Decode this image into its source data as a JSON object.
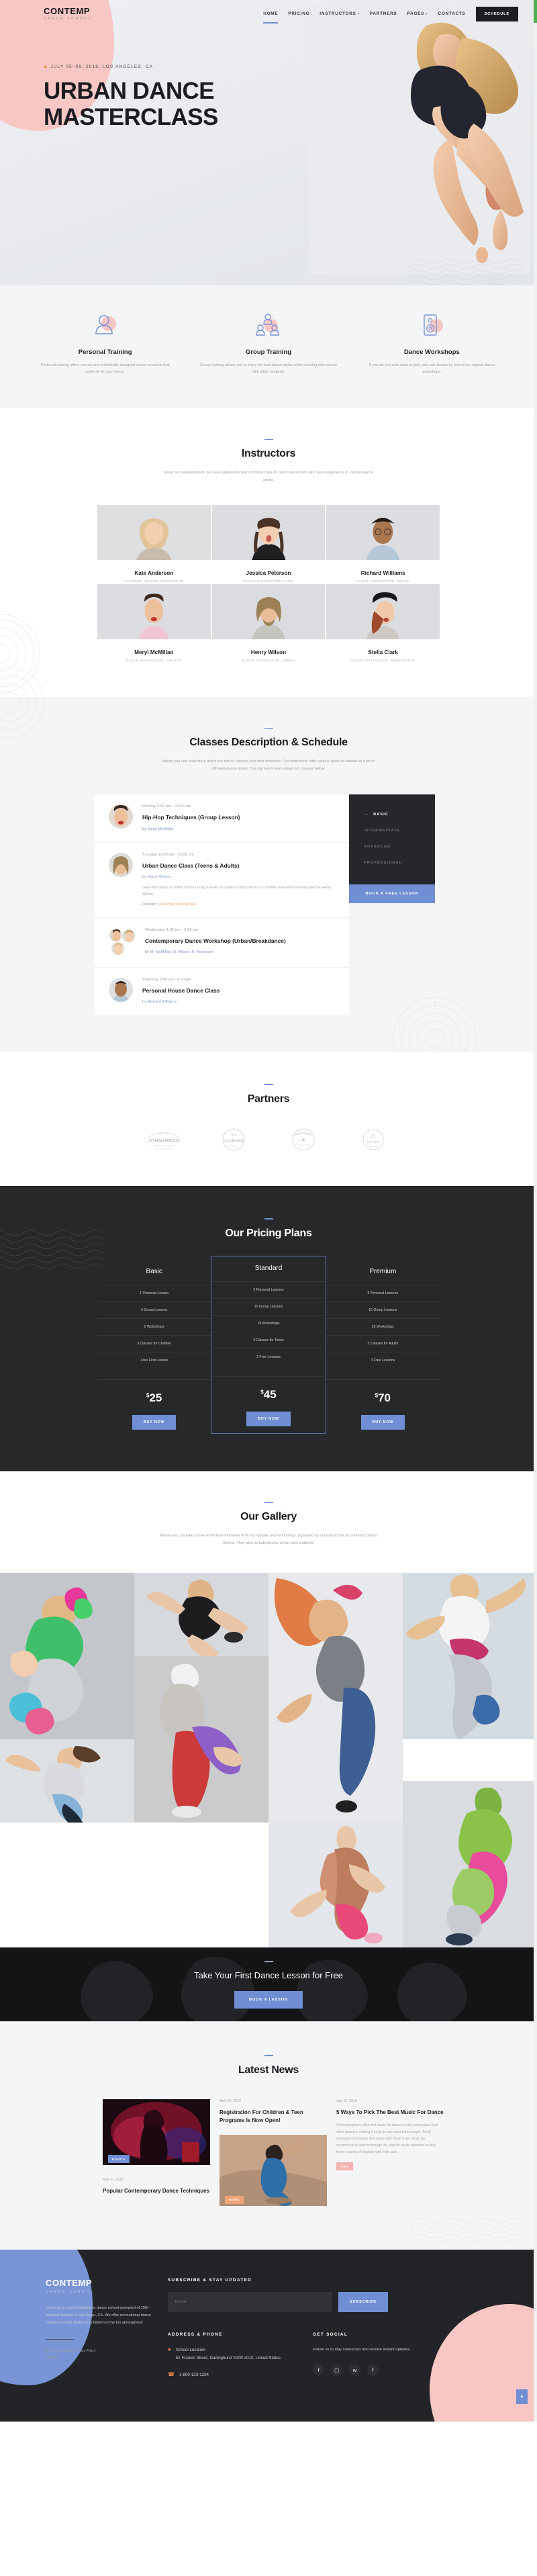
{
  "brand": {
    "name": "CONTEMP",
    "sub": "DANCE SCHOOL"
  },
  "nav": {
    "items": [
      {
        "label": "HOME",
        "caret": "",
        "active": true
      },
      {
        "label": "PRICING",
        "caret": "",
        "active": false
      },
      {
        "label": "INSTRUCTORS",
        "caret": "▾",
        "active": false
      },
      {
        "label": "PARTNERS",
        "caret": "",
        "active": false
      },
      {
        "label": "PAGES",
        "caret": "▾",
        "active": false
      },
      {
        "label": "CONTACTS",
        "caret": "",
        "active": false
      }
    ],
    "cta_label": "SCHEDULE"
  },
  "hero": {
    "date": "JULY 05–09, 2018, LOS ANGELES, CA",
    "title_line1": "URBAN DANCE",
    "title_line2": "MASTERCLASS",
    "pin_icon": "location-pin-icon"
  },
  "services": [
    {
      "icon": "person-icon",
      "title": "Personal Training",
      "text": "Personal training offers one-on-one individually designed dance sessions that perfectly fit your needs."
    },
    {
      "icon": "group-icon",
      "title": "Group Training",
      "text": "Group training allows you to enjoy the best dance styles while learning new moves with other students."
    },
    {
      "icon": "speaker-icon",
      "title": "Dance Workshops",
      "text": "If you are not sure what to pick, you can always try one of our regular dance workshops."
    }
  ],
  "instructors": {
    "title": "Instructors",
    "subtitle": "Since our establishment, we have gathered a team of more than 20 dance instructors who have experience in various dance styles.",
    "people": [
      {
        "name": "Kate Anderson",
        "role": "FOUNDER, SENIOR INSTRUCTOR"
      },
      {
        "name": "Jessica Peterson",
        "role": "DANCE INSTRUCTOR, LATIN"
      },
      {
        "name": "Richard Williams",
        "role": "DANCE INSTRUCTOR, HOUSE"
      },
      {
        "name": "Meryl McMillan",
        "role": "DANCE INSTRUCTOR, HIP-HOP"
      },
      {
        "name": "Henry Wilson",
        "role": "DANCE INSTRUCTOR, URBAN"
      },
      {
        "name": "Stella Clark",
        "role": "DANCE INSTRUCTOR, BREAKDANCE"
      }
    ]
  },
  "schedule": {
    "title": "Classes Description & Schedule",
    "subtitle": "Below you can read more about our dance classes and their schedule. Our instructors offer various types of classes in a lot of different dance styles. You can learn more about our classes below.",
    "items": [
      {
        "time": "Monday 9:00 am - 10:00 am",
        "name": "Hip-Hop Techniques (Group Lesson)",
        "by_prefix": "by ",
        "by": "Meryl McMillan",
        "desc": "",
        "loc_label": "",
        "loc": ""
      },
      {
        "time": "Tuesday 11:00 am - 12:00 pm",
        "name": "Urban Dance Class (Teens & Adults)",
        "by_prefix": "by ",
        "by": "Henry Wilson",
        "desc": "Learn the basics of Urban Dance during a series of classes conducted by our certified and award-winning teacher Henry Wilson.",
        "loc_label": "Location: ",
        "loc": "Contemp Training Hall"
      },
      {
        "time": "Wednesday 1:00 pm - 2:00 pm",
        "name": "Contemporary Dance Workshop (Urban/Breakdance)",
        "by_prefix": "by ",
        "by": "M. McMillan, H. Wilson, K. Anderson",
        "desc": "",
        "loc_label": "",
        "loc": ""
      },
      {
        "time": "Thursday 3:00 pm - 4:00 pm",
        "name": "Personal House Dance Class",
        "by_prefix": "by ",
        "by": "Richard Williams",
        "desc": "",
        "loc_label": "",
        "loc": ""
      }
    ],
    "levels": [
      {
        "label": "BASIC",
        "active": true
      },
      {
        "label": "INTERMEDIATE",
        "active": false
      },
      {
        "label": "ADVANCED",
        "active": false
      },
      {
        "label": "PROFESSIONAL",
        "active": false
      }
    ],
    "book_label": "BOOK A FREE LESSON"
  },
  "partners": {
    "title": "Partners",
    "logos": [
      "JOHN & BRAD",
      "THE OLDBARN",
      "WEST COAST",
      "ESTABLISHED"
    ]
  },
  "pricing": {
    "title": "Our Pricing Plans",
    "buy_label": "BUY NOW",
    "accent": "#6f8ed4",
    "plans": [
      {
        "name": "Basic",
        "features": [
          "1 Personal Lesson",
          "3 Group Lessons",
          "5 Workshops",
          "3 Classes for Children",
          "Free First Lesson"
        ],
        "currency": "$",
        "price": "25",
        "featured": false
      },
      {
        "name": "Standard",
        "features": [
          "3 Personal Lessons",
          "10 Group Lessons",
          "15 Workshops",
          "3 Classes for Teens",
          "2 Free Lessons"
        ],
        "currency": "$",
        "price": "45",
        "featured": true
      },
      {
        "name": "Premium",
        "features": [
          "5 Personal Lessons",
          "15 Group Lessons",
          "25 Workshops",
          "3 Classes for Adults",
          "3 Free Lessons"
        ],
        "currency": "$",
        "price": "70",
        "featured": false
      }
    ]
  },
  "gallery": {
    "title": "Our Gallery",
    "subtitle": "Below you can take a look at the best moments from our classes and workshops organised by our instructors at Contemp Dance School. They also include photos of our best students."
  },
  "cta": {
    "title": "Take Your First Dance Lesson for Free",
    "button": "BOOK A LESSON"
  },
  "news": {
    "title": "Latest News",
    "posts": [
      {
        "date": "April 25, 2018",
        "title": "Registration For Children & Teen Programs Is Now Open!",
        "text": "",
        "tag": "",
        "tag_color": ""
      },
      {
        "date": "July 02, 2018",
        "title": "5 Ways To Pick The Best Music For Dance",
        "text": "Choreographers often find music for dances in the same place from other dancers, making it tough to use something unique. Avoid overused composers and songs with these 5 tips. First, we recommend to search through the popular music websites as they have a variety of playlists with indie and...",
        "tag": "TIPS",
        "tag_color": "#f3b3ae"
      },
      {
        "date": "May 11, 2018",
        "title": "Popular Contemporary Dance Techniques",
        "text": "",
        "tag": "DANCE",
        "tag_color": "#6f8ed4"
      },
      {
        "date": "",
        "title": "",
        "text": "",
        "tag": "NEWS",
        "tag_color": "#f0a377"
      }
    ]
  },
  "footer": {
    "brand_name": "CONTEMP",
    "brand_sub": "DANCE SCHOOL",
    "about": "Contemp is a well-established dance school prompted of 150+ students located in San Diego, CA. We offer recreational dance classes for both adults and children in the fun atmosphere!",
    "copyright": "© 2024 Contemp. Privacy Policy",
    "copyright_extra": "Website",
    "subscribe_heading": "SUBSCRIBE & STAY UPDATED",
    "email_placeholder": "E-mail",
    "email_value": "",
    "subscribe_label": "SUBSCRIBE",
    "address_heading": "ADDRESS & PHONE",
    "location_label": "School Location",
    "address": "51 Francis Street, Darlinghurst NSW 2010, United States",
    "phone": "1-800-123-1234",
    "social_heading": "GET SOCIAL",
    "social_text": "Follow us to stay connected and receive instant updates.",
    "socials": [
      "facebook-icon",
      "instagram-icon",
      "twitter-icon",
      "facebook-alt-icon"
    ],
    "to_top_icon": "arrow-up-icon"
  }
}
